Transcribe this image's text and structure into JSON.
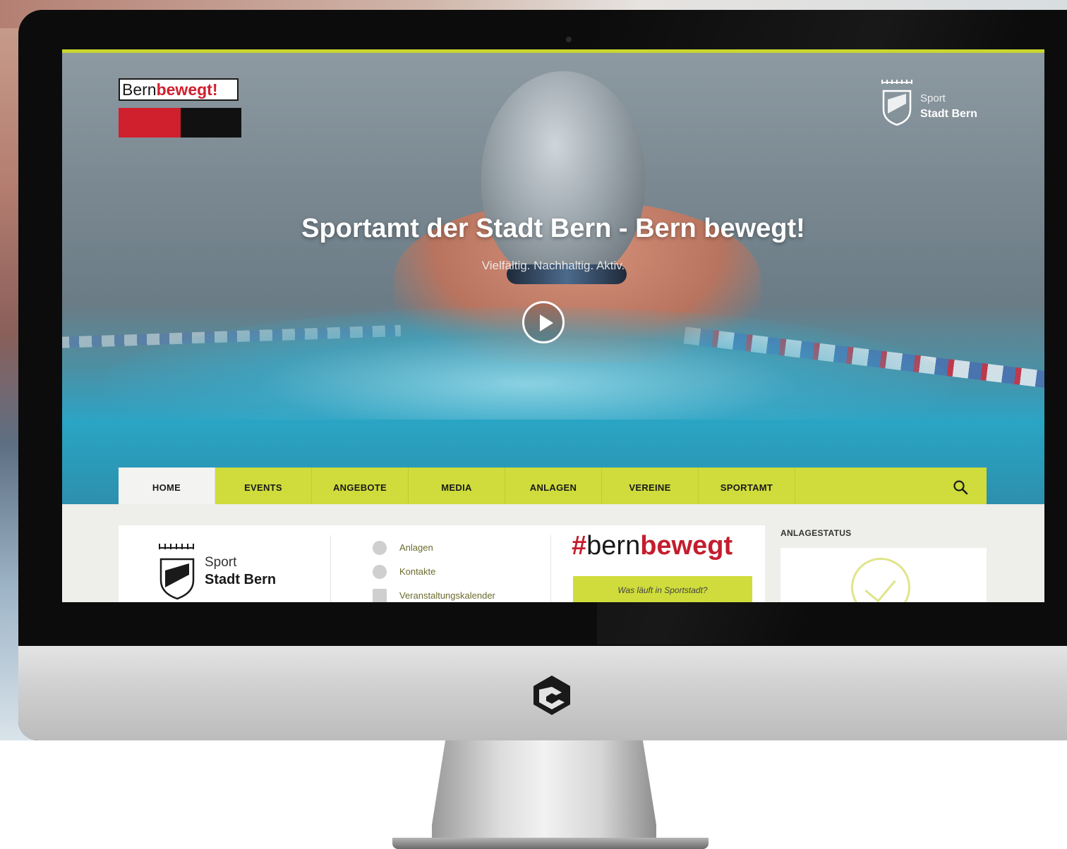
{
  "brand": {
    "logo_plain": "Bern",
    "logo_bold": "bewegt!",
    "colors": {
      "red": "#d0202e",
      "black": "#111111",
      "accent": "#cfdc3b"
    }
  },
  "sport_logo": {
    "line1": "Sport",
    "line2": "Stadt Bern"
  },
  "hero": {
    "title": "Sportamt der Stadt Bern - Bern bewegt!",
    "subtitle": "Vielfältig. Nachhaltig. Aktiv."
  },
  "nav": {
    "items": [
      {
        "label": "HOME",
        "active": true
      },
      {
        "label": "EVENTS"
      },
      {
        "label": "ANGEBOTE"
      },
      {
        "label": "MEDIA"
      },
      {
        "label": "ANLAGEN"
      },
      {
        "label": "VEREINE"
      },
      {
        "label": "SPORTAMT"
      }
    ],
    "search_icon": "search-icon"
  },
  "content": {
    "links": [
      {
        "label": "Anlagen",
        "icon": "info-icon"
      },
      {
        "label": "Kontakte",
        "icon": "contacts-icon"
      },
      {
        "label": "Veranstaltungskalender",
        "icon": "calendar-icon"
      }
    ],
    "hashtag": {
      "symbol": "#",
      "plain": "bern",
      "bold": "bewegt"
    },
    "cta_label": "Was läuft in Sportstadt?",
    "status_label": "ANLAGESTATUS"
  }
}
